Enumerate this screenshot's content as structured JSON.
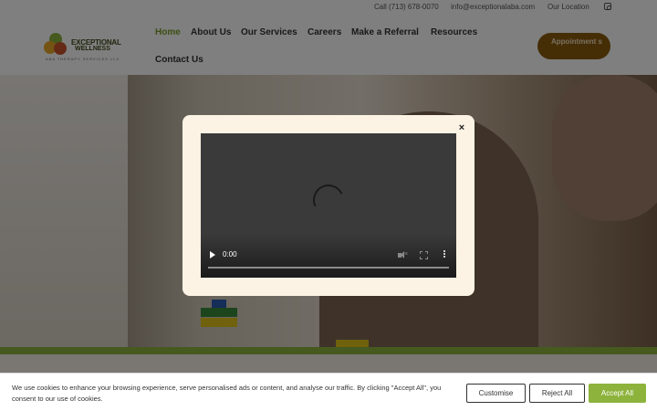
{
  "topbar": {
    "phone": "Call (713) 678-0070",
    "email": "info@exceptionalaba.com",
    "location": "Our Location",
    "instagram_icon": "instagram-icon"
  },
  "logo": {
    "name_line1": "EXCEPTIONAL",
    "name_line2": "WELLNESS",
    "tagline": "ABA THERAPY SERVICES LLC"
  },
  "nav": {
    "items": [
      {
        "label": "Home",
        "active": true
      },
      {
        "label": "About Us"
      },
      {
        "label": "Our Services"
      },
      {
        "label": "Careers"
      },
      {
        "label": "Make a Referral"
      },
      {
        "label": "Resources"
      },
      {
        "label": "Contact Us"
      }
    ],
    "appointment_button": "Appointment s"
  },
  "modal": {
    "close_label": "×",
    "video": {
      "time": "0:00",
      "progress": 0
    }
  },
  "cookie_banner": {
    "text": "We use cookies to enhance your browsing experience, serve personalised ads or content, and analyse our traffic. By clicking \"Accept All\", you consent to our use of cookies.",
    "customise": "Customise",
    "reject": "Reject All",
    "accept": "Accept All"
  },
  "colors": {
    "brand_green": "#8db33c",
    "appointment_brown": "#8a5a0d",
    "modal_background": "#fdf3e4"
  }
}
